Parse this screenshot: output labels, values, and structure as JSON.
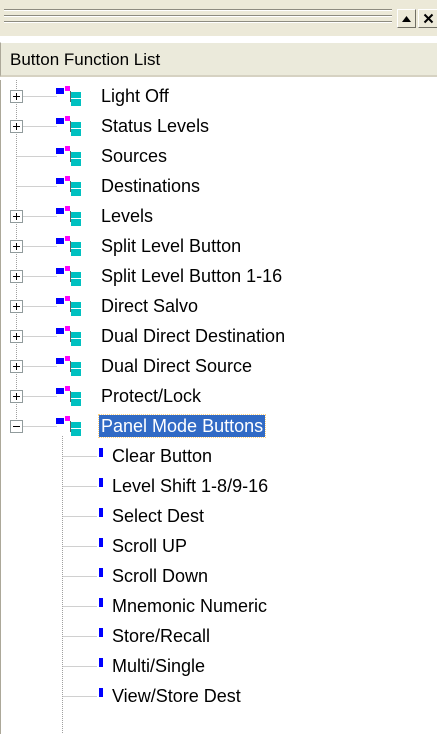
{
  "window": {
    "pin_icon": "scroll-up-arrow-icon",
    "close_icon": "close-icon"
  },
  "list": {
    "header": "Button Function List",
    "items": [
      {
        "label": "Light Off",
        "expandable": true
      },
      {
        "label": "Status Levels",
        "expandable": true
      },
      {
        "label": "Sources",
        "expandable": false
      },
      {
        "label": "Destinations",
        "expandable": false
      },
      {
        "label": "Levels",
        "expandable": true
      },
      {
        "label": "Split Level Button",
        "expandable": true
      },
      {
        "label": "Split Level Button 1-16",
        "expandable": true
      },
      {
        "label": "Direct Salvo",
        "expandable": true
      },
      {
        "label": "Dual Direct Destination",
        "expandable": true
      },
      {
        "label": "Dual Direct Source",
        "expandable": true
      },
      {
        "label": "Protect/Lock",
        "expandable": true
      },
      {
        "label": "Panel Mode Buttons",
        "expandable": true,
        "expanded": true,
        "selected": true
      }
    ],
    "children": [
      "Clear Button",
      "Level Shift 1-8/9-16",
      "Select Dest",
      "Scroll UP",
      "Scroll Down",
      "Mnemonic Numeric",
      "Store/Recall",
      "Multi/Single",
      "View/Store Dest"
    ]
  },
  "colors": {
    "selection": "#316ac5",
    "icon_blue": "#0000ff",
    "icon_magenta": "#ff00ff",
    "icon_cyan": "#00c0c0"
  }
}
